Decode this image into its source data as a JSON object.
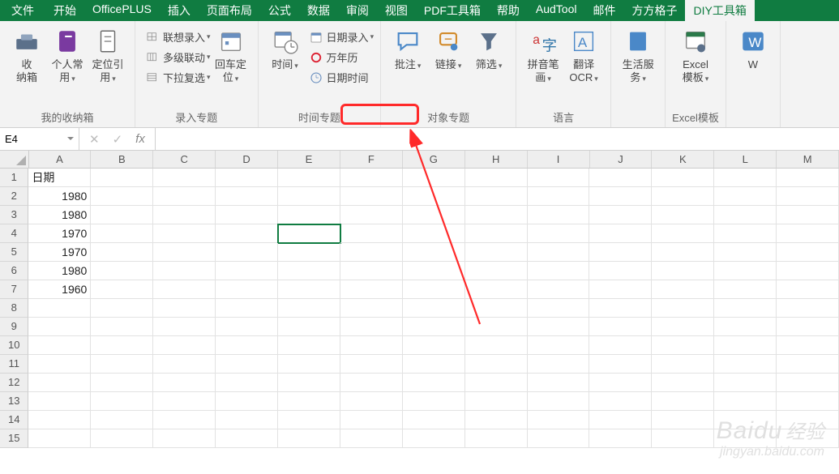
{
  "tabs": [
    "文件",
    "开始",
    "OfficePLUS",
    "插入",
    "页面布局",
    "公式",
    "数据",
    "审阅",
    "视图",
    "PDF工具箱",
    "帮助",
    "AudTool",
    "邮件",
    "方方格子",
    "DIY工具箱"
  ],
  "active_tab_index": 14,
  "ribbon": {
    "groups": [
      {
        "label": "我的收纳箱",
        "big": [
          {
            "name": "storage-box",
            "icon": "toolbox",
            "label": "收\n纳箱"
          },
          {
            "name": "personal-use",
            "icon": "purple-book",
            "label": "个人常\n用",
            "dd": true
          },
          {
            "name": "locate-ref",
            "icon": "page",
            "label": "定位引\n用",
            "dd": true
          }
        ]
      },
      {
        "label": "录入专题",
        "small": [
          {
            "name": "linked-input",
            "icon": "grid-refresh",
            "label": "联想录入",
            "dd": true
          },
          {
            "name": "multi-linkage",
            "icon": "grid-cols",
            "label": "多级联动",
            "dd": true
          },
          {
            "name": "dropdown-copy",
            "icon": "grid-copy",
            "label": "下拉复选",
            "dd": true
          }
        ],
        "big": [
          {
            "name": "back-locate",
            "icon": "calendar",
            "label": "回车定\n位",
            "dd": true
          }
        ]
      },
      {
        "label": "时间专题",
        "big": [
          {
            "name": "time",
            "icon": "date-clock",
            "label": "时间",
            "dd": true
          }
        ],
        "small": [
          {
            "name": "date-input",
            "icon": "date",
            "label": "日期录入",
            "dd": true
          },
          {
            "name": "perpetual-cal",
            "icon": "red-circle",
            "label": "万年历"
          },
          {
            "name": "date-time",
            "icon": "clock",
            "label": "日期时间"
          }
        ]
      },
      {
        "label": "对象专题",
        "big": [
          {
            "name": "annotate",
            "icon": "speech",
            "label": "批注",
            "dd": true
          },
          {
            "name": "link",
            "icon": "chain",
            "label": "链接",
            "dd": true
          },
          {
            "name": "filter",
            "icon": "funnel",
            "label": "筛选",
            "dd": true
          }
        ]
      },
      {
        "label": "语言",
        "big": [
          {
            "name": "pinyin",
            "icon": "pinyin",
            "label": "拼音笔\n画",
            "dd": true
          },
          {
            "name": "translate",
            "icon": "ocr",
            "label": "翻译\nOCR",
            "dd": true
          }
        ]
      },
      {
        "label": "",
        "big": [
          {
            "name": "life-service",
            "icon": "blue-square",
            "label": "生活服\n务",
            "dd": true
          }
        ]
      },
      {
        "label": "Excel模板",
        "big": [
          {
            "name": "excel-template",
            "icon": "template",
            "label": "Excel\n模板",
            "dd": true
          }
        ]
      },
      {
        "label": "",
        "big": [
          {
            "name": "w-partial",
            "icon": "w",
            "label": "W"
          }
        ]
      }
    ]
  },
  "highlight_group_label": "时间专题",
  "formula_bar": {
    "namebox": "E4",
    "value": ""
  },
  "columns": [
    "A",
    "B",
    "C",
    "D",
    "E",
    "F",
    "G",
    "H",
    "I",
    "J",
    "K",
    "L",
    "M"
  ],
  "row_count": 15,
  "selected": {
    "row": 4,
    "col": "E"
  },
  "cells": {
    "A1": {
      "v": "日期",
      "align": "left"
    },
    "A2": {
      "v": "1980"
    },
    "A3": {
      "v": "1980"
    },
    "A4": {
      "v": "1970"
    },
    "A5": {
      "v": "1970"
    },
    "A6": {
      "v": "1980"
    },
    "A7": {
      "v": "1960"
    }
  },
  "watermark": {
    "brand": "Baidu",
    "cn": "经验",
    "url": "jingyan.baidu.com"
  }
}
